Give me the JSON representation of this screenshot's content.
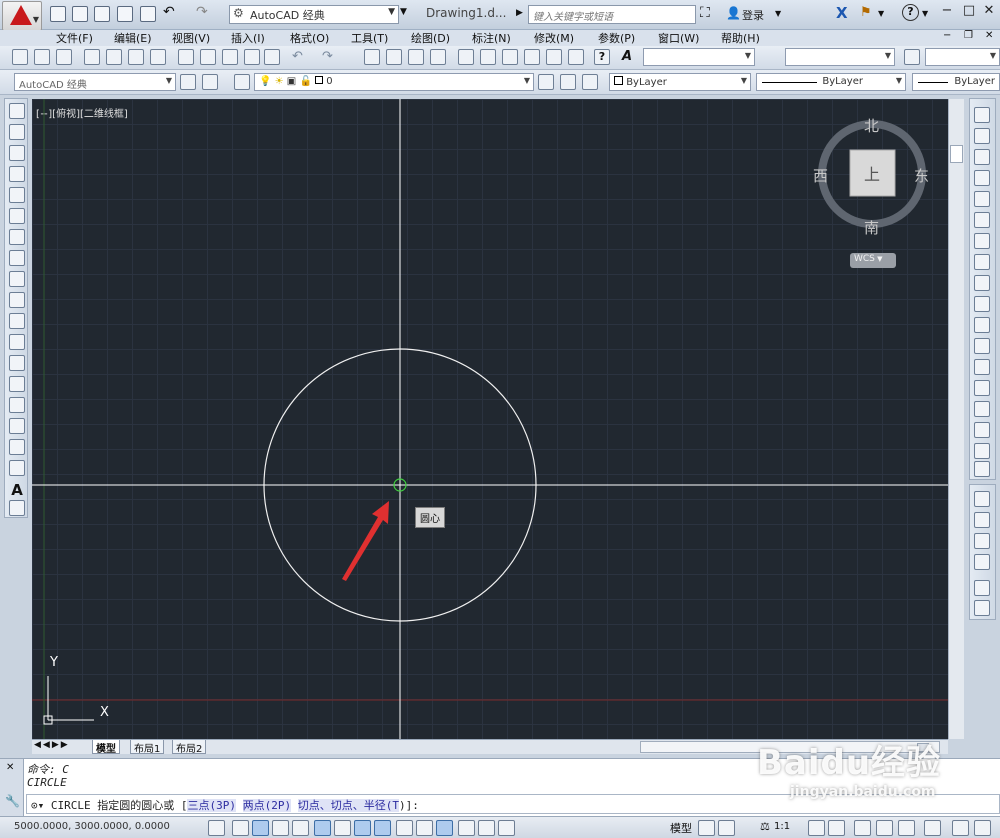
{
  "titlebar": {
    "workspace": "AutoCAD 经典",
    "doc_title": "Drawing1.d...",
    "search_placeholder": "键入关键字或短语",
    "login": "登录"
  },
  "menus": [
    "文件(F)",
    "编辑(E)",
    "视图(V)",
    "插入(I)",
    "格式(O)",
    "工具(T)",
    "绘图(D)",
    "标注(N)",
    "修改(M)",
    "参数(P)",
    "窗口(W)",
    "帮助(H)"
  ],
  "toolbars": {
    "workspace_combo": "AutoCAD 经典",
    "layer_combo": "0",
    "color_combo": "ByLayer",
    "linetype_combo": "ByLayer",
    "lineweight_combo": "ByLayer"
  },
  "viewport": {
    "label": "[−][俯视][二维线框]",
    "tooltip": "圆心",
    "axis_y": "Y",
    "axis_x": "X"
  },
  "viewcube": {
    "north": "北",
    "south": "南",
    "east": "东",
    "west": "西",
    "face": "上",
    "wcs": "WCS"
  },
  "tabs": [
    "模型",
    "布局1",
    "布局2"
  ],
  "command": {
    "history1": "命令: C",
    "history2": "CIRCLE",
    "prompt_prefix": "CIRCLE 指定圆的圆心或 [",
    "opt1": "三点(3P)",
    "opt2": "两点(2P)",
    "opt3_pre": "切点、切点、半径(",
    "opt3_key": "T",
    "prompt_suffix": ")]:"
  },
  "statusbar": {
    "coords": "5000.0000, 3000.0000, 0.0000",
    "model": "模型",
    "scale": "1:1"
  },
  "watermark": {
    "brand": "Baidu经验",
    "url": "jingyan.baidu.com"
  },
  "colors": {
    "canvas_bg": "#212830",
    "accent_red": "#e03030",
    "snap_green": "#3fcf3f"
  }
}
